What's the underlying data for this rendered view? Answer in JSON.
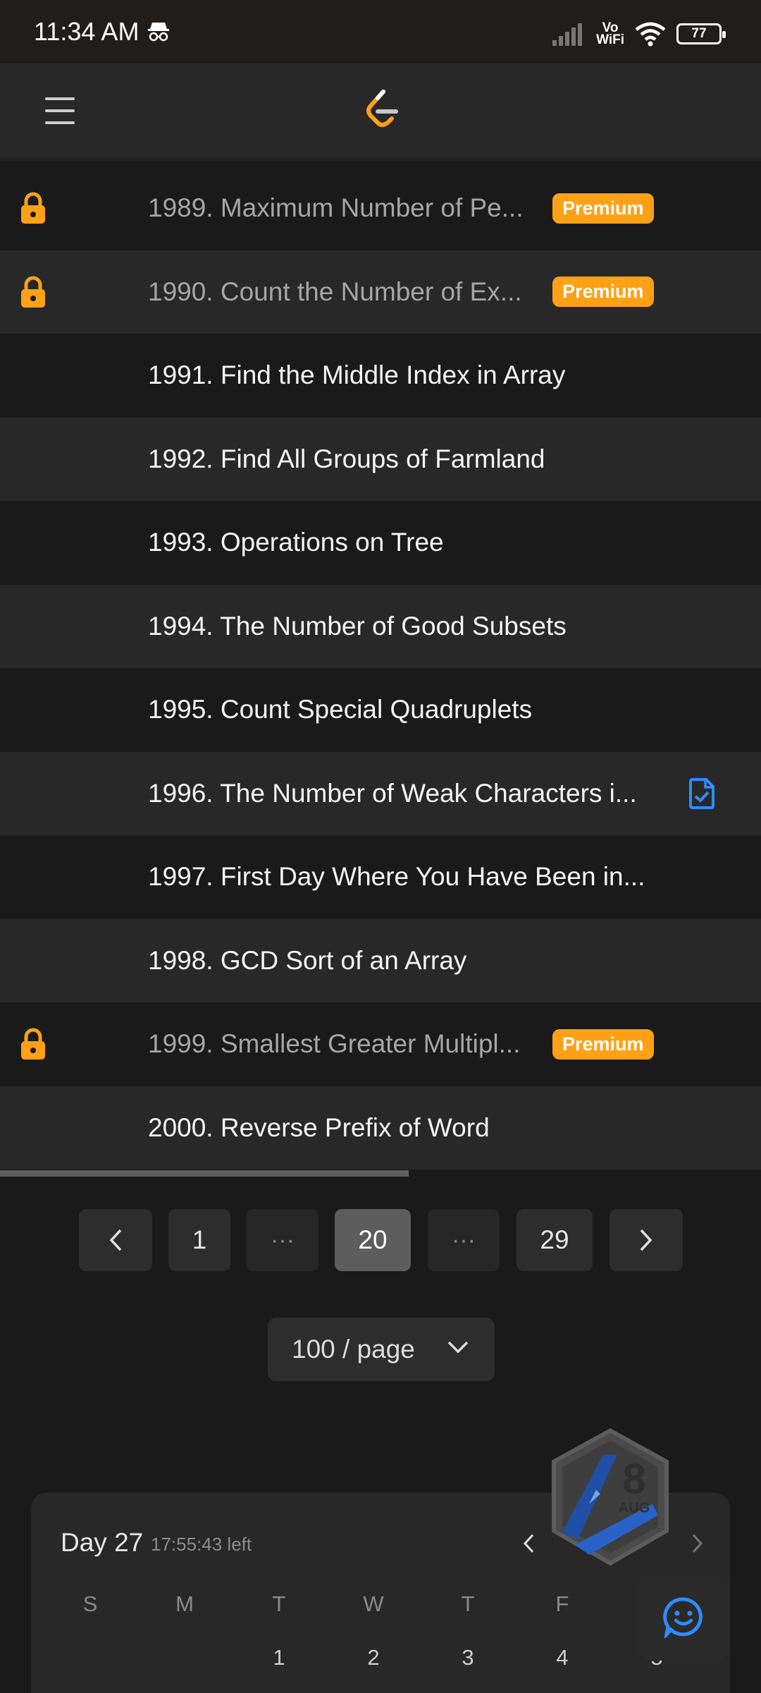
{
  "status_bar": {
    "time": "11:34 AM",
    "vowifi_top": "Vo",
    "vowifi_bottom": "WiFi",
    "battery": "77"
  },
  "problems": [
    {
      "title": "1989. Maximum Number of Pe...",
      "locked": true,
      "premium": "Premium",
      "solved": false
    },
    {
      "title": "1990. Count the Number of Ex...",
      "locked": true,
      "premium": "Premium",
      "solved": false
    },
    {
      "title": "1991. Find the Middle Index in Array",
      "locked": false,
      "premium": "",
      "solved": false
    },
    {
      "title": "1992. Find All Groups of Farmland",
      "locked": false,
      "premium": "",
      "solved": false
    },
    {
      "title": "1993. Operations on Tree",
      "locked": false,
      "premium": "",
      "solved": false
    },
    {
      "title": "1994. The Number of Good Subsets",
      "locked": false,
      "premium": "",
      "solved": false
    },
    {
      "title": "1995. Count Special Quadruplets",
      "locked": false,
      "premium": "",
      "solved": false
    },
    {
      "title": "1996. The Number of Weak Characters i...",
      "locked": false,
      "premium": "",
      "solved": true
    },
    {
      "title": "1997. First Day Where You Have Been in...",
      "locked": false,
      "premium": "",
      "solved": false
    },
    {
      "title": "1998. GCD Sort of an Array",
      "locked": false,
      "premium": "",
      "solved": false
    },
    {
      "title": "1999. Smallest Greater Multipl...",
      "locked": true,
      "premium": "Premium",
      "solved": false
    },
    {
      "title": "2000. Reverse Prefix of Word",
      "locked": false,
      "premium": "",
      "solved": false
    }
  ],
  "pagination": {
    "first": "1",
    "current": "20",
    "last": "29",
    "ellipsis": "···"
  },
  "page_size": "100 / page",
  "calendar": {
    "day": "Day 27",
    "time_left": "17:55:43 left",
    "weekdays": [
      "S",
      "M",
      "T",
      "W",
      "T",
      "F",
      "S"
    ],
    "dates": [
      "1",
      "2",
      "3",
      "4",
      "5"
    ]
  },
  "badge": {
    "number": "8",
    "month": "AUG"
  },
  "colors": {
    "accent": "#ffa116",
    "solved_blue": "#2f8cff",
    "background": "#1a1a1a"
  }
}
